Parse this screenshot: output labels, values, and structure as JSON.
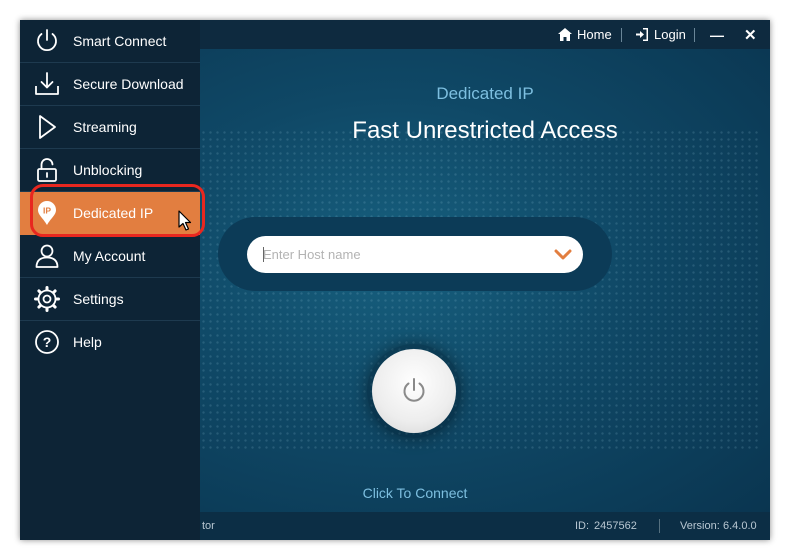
{
  "titlebar": {
    "home_label": "Home",
    "login_label": "Login",
    "minimize_glyph": "—",
    "close_glyph": "✕"
  },
  "sidebar": {
    "items": [
      {
        "label": "Smart Connect",
        "icon": "power-icon",
        "active": false
      },
      {
        "label": "Secure Download",
        "icon": "download-icon",
        "active": false
      },
      {
        "label": "Streaming",
        "icon": "play-icon",
        "active": false
      },
      {
        "label": "Unblocking",
        "icon": "unlock-icon",
        "active": false
      },
      {
        "label": "Dedicated IP",
        "icon": "ip-pin-icon",
        "active": true
      },
      {
        "label": "My Account",
        "icon": "user-icon",
        "active": false
      },
      {
        "label": "Settings",
        "icon": "gear-icon",
        "active": false
      },
      {
        "label": "Help",
        "icon": "help-icon",
        "active": false
      }
    ]
  },
  "main": {
    "subtitle": "Dedicated IP",
    "headline": "Fast Unrestricted Access",
    "host_input": {
      "value": "",
      "placeholder": "Enter Host name"
    },
    "connect_text": "Click To Connect"
  },
  "statusbar": {
    "left_fragment": "tor",
    "id_label": "ID:",
    "id_value": "2457562",
    "version_label": "Version:",
    "version_value": "6.4.0.0"
  },
  "colors": {
    "accent": "#e27e40",
    "sidebar_bg": "#0d2436",
    "main_bg": "#0f4866",
    "highlight": "#e8271f"
  }
}
